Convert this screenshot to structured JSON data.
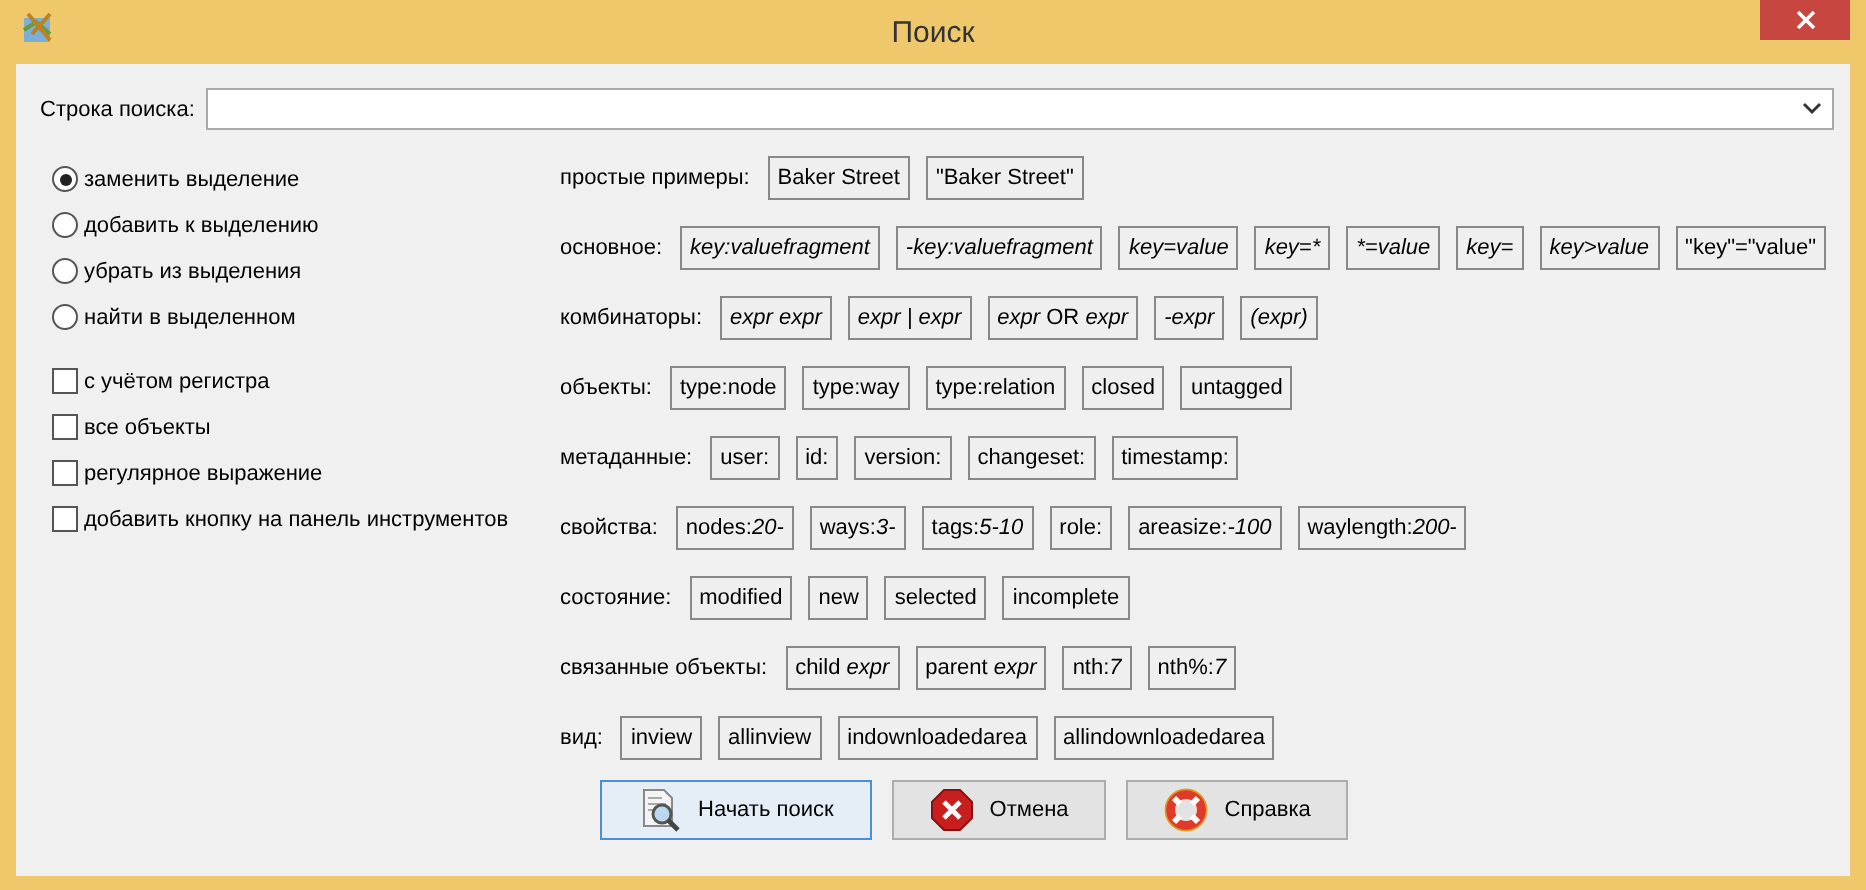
{
  "window": {
    "title": "Поиск"
  },
  "search": {
    "label": "Строка поиска:"
  },
  "modes": [
    {
      "label": "заменить выделение",
      "selected": true
    },
    {
      "label": "добавить к выделению",
      "selected": false
    },
    {
      "label": "убрать из выделения",
      "selected": false
    },
    {
      "label": "найти в выделенном",
      "selected": false
    }
  ],
  "options": [
    {
      "label": "с учётом регистра",
      "checked": false
    },
    {
      "label": "все объекты",
      "checked": false
    },
    {
      "label": "регулярное выражение",
      "checked": false
    },
    {
      "label": "добавить кнопку на панель инструментов",
      "checked": false
    }
  ],
  "examples": [
    {
      "label": "простые примеры:",
      "chips": [
        [
          {
            "text": "Baker Street",
            "italic": false
          }
        ],
        [
          {
            "text": "\"Baker Street\"",
            "italic": false
          }
        ]
      ]
    },
    {
      "label": "основное:",
      "chips": [
        [
          {
            "text": "key:valuefragment",
            "italic": true
          }
        ],
        [
          {
            "text": "-key:valuefragment",
            "italic": true
          }
        ],
        [
          {
            "text": "key=value",
            "italic": true
          }
        ],
        [
          {
            "text": "key=*",
            "italic": true
          }
        ],
        [
          {
            "text": "*=value",
            "italic": true
          }
        ],
        [
          {
            "text": "key=",
            "italic": true
          }
        ],
        [
          {
            "text": "key>value",
            "italic": true
          }
        ],
        [
          {
            "text": "\"key\"=\"value\"",
            "italic": false
          }
        ]
      ]
    },
    {
      "label": "комбинаторы:",
      "chips": [
        [
          {
            "text": "expr expr",
            "italic": true
          }
        ],
        [
          {
            "text": "expr | expr",
            "italic": true
          }
        ],
        [
          {
            "text": "expr",
            "italic": true
          },
          {
            "text": " OR ",
            "italic": false
          },
          {
            "text": "expr",
            "italic": true
          }
        ],
        [
          {
            "text": "-expr",
            "italic": true
          }
        ],
        [
          {
            "text": "(expr)",
            "italic": true
          }
        ]
      ]
    },
    {
      "label": "объекты:",
      "chips": [
        [
          {
            "text": "type:node",
            "italic": false
          }
        ],
        [
          {
            "text": "type:way",
            "italic": false
          }
        ],
        [
          {
            "text": "type:relation",
            "italic": false
          }
        ],
        [
          {
            "text": "closed",
            "italic": false
          }
        ],
        [
          {
            "text": "untagged",
            "italic": false
          }
        ]
      ]
    },
    {
      "label": "метаданные:",
      "chips": [
        [
          {
            "text": "user:",
            "italic": false
          }
        ],
        [
          {
            "text": "id:",
            "italic": false
          }
        ],
        [
          {
            "text": "version:",
            "italic": false
          }
        ],
        [
          {
            "text": "changeset:",
            "italic": false
          }
        ],
        [
          {
            "text": "timestamp:",
            "italic": false
          }
        ]
      ]
    },
    {
      "label": "свойства:",
      "chips": [
        [
          {
            "text": "nodes:",
            "italic": false
          },
          {
            "text": "20-",
            "italic": true
          }
        ],
        [
          {
            "text": "ways:",
            "italic": false
          },
          {
            "text": "3-",
            "italic": true
          }
        ],
        [
          {
            "text": "tags:",
            "italic": false
          },
          {
            "text": "5-10",
            "italic": true
          }
        ],
        [
          {
            "text": "role:",
            "italic": false
          }
        ],
        [
          {
            "text": "areasize:",
            "italic": false
          },
          {
            "text": "-100",
            "italic": true
          }
        ],
        [
          {
            "text": "waylength:",
            "italic": false
          },
          {
            "text": "200-",
            "italic": true
          }
        ]
      ]
    },
    {
      "label": "состояние:",
      "chips": [
        [
          {
            "text": "modified",
            "italic": false
          }
        ],
        [
          {
            "text": "new",
            "italic": false
          }
        ],
        [
          {
            "text": "selected",
            "italic": false
          }
        ],
        [
          {
            "text": "incomplete",
            "italic": false
          }
        ]
      ]
    },
    {
      "label": "связанные объекты:",
      "chips": [
        [
          {
            "text": "child ",
            "italic": false
          },
          {
            "text": "expr",
            "italic": true
          }
        ],
        [
          {
            "text": "parent ",
            "italic": false
          },
          {
            "text": "expr",
            "italic": true
          }
        ],
        [
          {
            "text": "nth:",
            "italic": false
          },
          {
            "text": "7",
            "italic": true
          }
        ],
        [
          {
            "text": "nth%:",
            "italic": false
          },
          {
            "text": "7",
            "italic": true
          }
        ]
      ]
    },
    {
      "label": "вид:",
      "chips": [
        [
          {
            "text": "inview",
            "italic": false
          }
        ],
        [
          {
            "text": "allinview",
            "italic": false
          }
        ],
        [
          {
            "text": "indownloadedarea",
            "italic": false
          }
        ],
        [
          {
            "text": "allindownloadedarea",
            "italic": false
          }
        ]
      ]
    }
  ],
  "buttons": [
    {
      "label": "Начать поиск",
      "kind": "search",
      "selected": true
    },
    {
      "label": "Отмена",
      "kind": "cancel",
      "selected": false
    },
    {
      "label": "Справка",
      "kind": "help",
      "selected": false
    }
  ]
}
